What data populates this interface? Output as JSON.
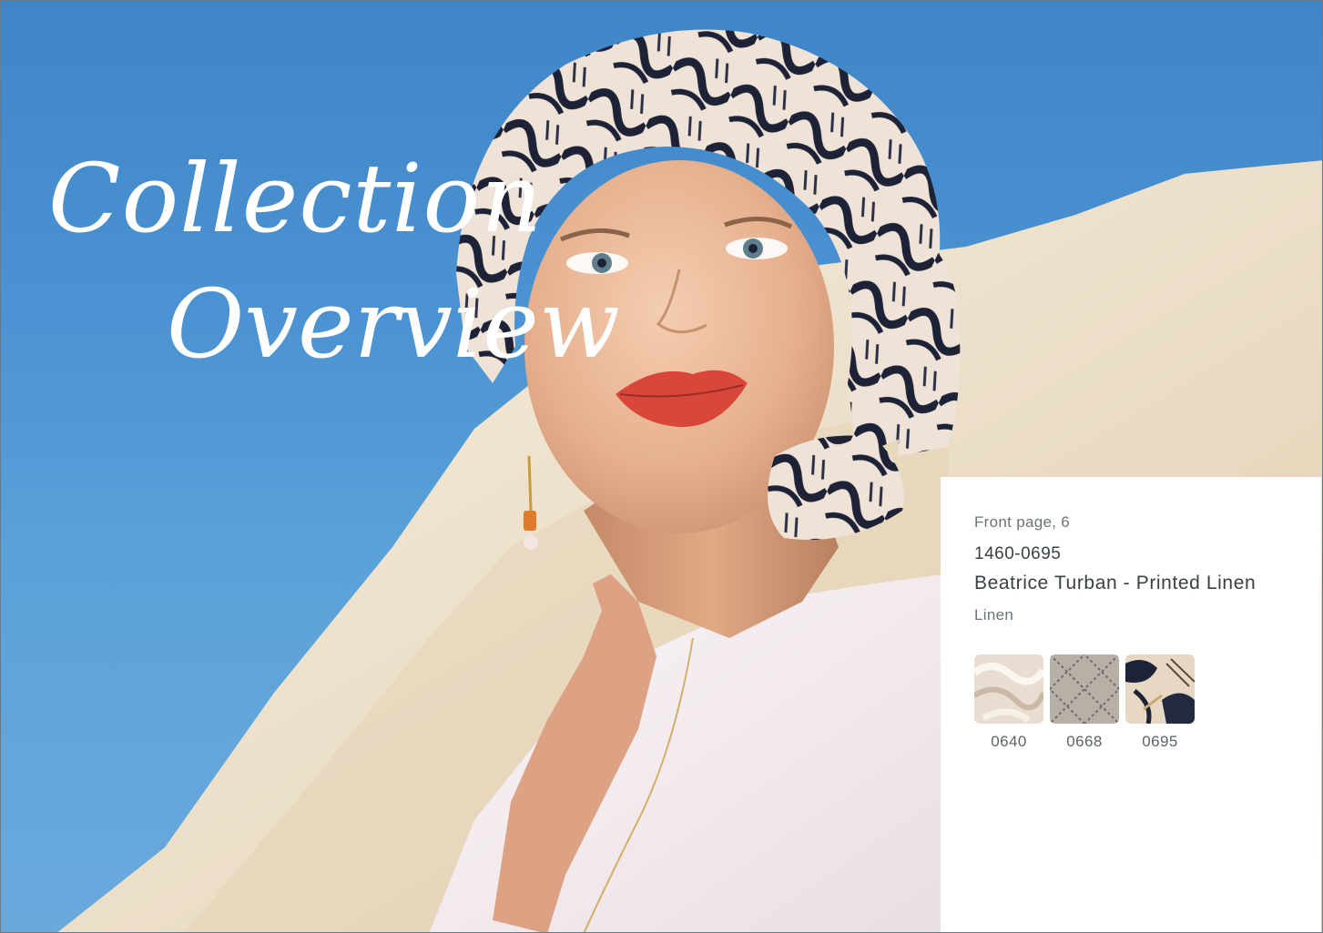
{
  "title": {
    "line1": "Collection",
    "line2": "Overview"
  },
  "product": {
    "reference": "Front page, 6",
    "code": "1460-0695",
    "name": "Beatrice Turban - Printed Linen",
    "material": "Linen",
    "swatches": [
      {
        "code": "0640"
      },
      {
        "code": "0668"
      },
      {
        "code": "0695"
      }
    ]
  },
  "colors": {
    "sky": "#4b93d2",
    "sand": "#f1e6d2",
    "scarf_dark": "#1d2236",
    "lips": "#d9473a"
  }
}
